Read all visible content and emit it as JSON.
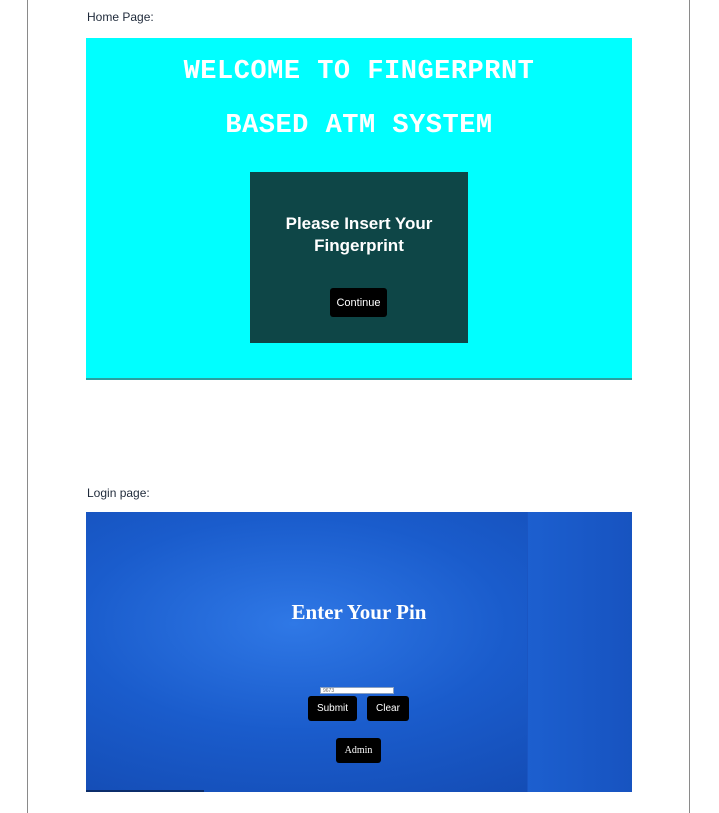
{
  "home_caption": "Home Page:",
  "home": {
    "title_line1": "WELCOME TO FINGERPRNT",
    "title_line2": "BASED ATM SYSTEM",
    "prompt_line1": "Please Insert Your",
    "prompt_line2": "Fingerprint",
    "continue_label": "Continue"
  },
  "login_caption": "Login page:",
  "login": {
    "title": "Enter Your Pin",
    "pin_value": "9673",
    "submit_label": "Submit",
    "clear_label": "Clear",
    "admin_label": "Admin"
  },
  "colors": {
    "home_background": "#00ffff",
    "home_panel": "#0e4647",
    "login_background": "#1a5ccc",
    "button": "#000000"
  }
}
